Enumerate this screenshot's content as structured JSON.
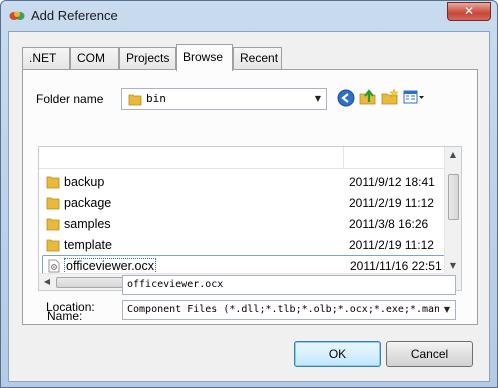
{
  "window": {
    "title": "Add Reference",
    "close_glyph": "✕"
  },
  "tabs": [
    {
      "label": ".NET",
      "active": false
    },
    {
      "label": "COM",
      "active": false
    },
    {
      "label": "Projects",
      "active": false
    },
    {
      "label": "Browse",
      "active": true
    },
    {
      "label": "Recent",
      "active": false
    }
  ],
  "folder": {
    "label": "Folder name",
    "value": "bin"
  },
  "toolbar_icons": [
    "back-icon",
    "up-folder-icon",
    "new-folder-icon",
    "view-menu-icon"
  ],
  "files": [
    {
      "name": "backup",
      "date": "2011/9/12 18:41",
      "type": "folder"
    },
    {
      "name": "package",
      "date": "2011/2/19 11:12",
      "type": "folder"
    },
    {
      "name": "samples",
      "date": "2011/3/8 16:26",
      "type": "folder"
    },
    {
      "name": "template",
      "date": "2011/2/19 11:12",
      "type": "folder"
    },
    {
      "name": "officeviewer.ocx",
      "date": "2011/11/16 22:51",
      "type": "file",
      "selected": true
    }
  ],
  "name_field": {
    "label": "Name:",
    "value": "officeviewer.ocx"
  },
  "location_field": {
    "label": "Location:",
    "value": "Component Files (*.dll;*.tlb;*.olb;*.ocx;*.exe;*.manifest)"
  },
  "buttons": {
    "ok": "OK",
    "cancel": "Cancel"
  },
  "colors": {
    "folder_yellow": "#e8b93a",
    "accent_blue": "#3c7fb1",
    "close_red": "#c6463a"
  }
}
